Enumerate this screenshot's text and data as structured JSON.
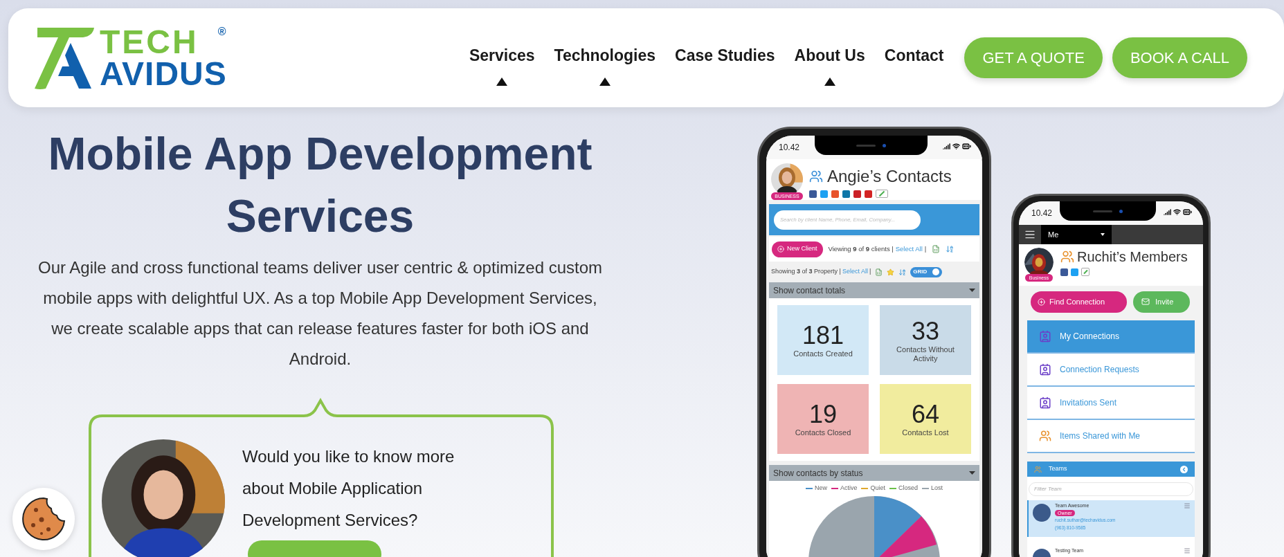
{
  "logo": {
    "line_1": "TECH",
    "line_2": "AVIDUS",
    "mark": "®"
  },
  "nav": [
    {
      "label": "Services",
      "has_menu": true
    },
    {
      "label": "Technologies",
      "has_menu": true
    },
    {
      "label": "Case Studies",
      "has_menu": false
    },
    {
      "label": "About Us",
      "has_menu": true
    },
    {
      "label": "Contact",
      "has_menu": false
    }
  ],
  "actions": [
    "GET A QUOTE",
    "BOOK A CALL"
  ],
  "hero": {
    "title": "Mobile App Development Services",
    "description": "Our Agile and cross functional teams deliver user centric & optimized custom mobile apps with delightful UX. As a top Mobile App Development Services, we create scalable apps that can release features faster for both iOS and Android."
  },
  "consult": {
    "question": "Would you like to know more about Mobile Application Development Services?"
  },
  "phone_1": {
    "time": "10.42",
    "title": "Angie’s Contacts",
    "badge": "BUSINESS",
    "search": {
      "placeholder": "Search by client Name, Phone, Email, Company..."
    },
    "new_button": "New Client",
    "viewing": "Viewing **9** of **9** clients |",
    "viewing_link": "Select All",
    "separator": "|",
    "showing": "Showing **3** of **3** Property |",
    "showing_link": "Select All",
    "toggle": {
      "label": "GRID",
      "on": true
    },
    "totals_header": "Show contact totals",
    "tiles": [
      {
        "value": "181",
        "label": "Contacts Created",
        "color": "#d2e8f6"
      },
      {
        "value": "33",
        "label": "Contacts Without Activity",
        "color": "#c9dbe8"
      },
      {
        "value": "19",
        "label": "Contacts Closed",
        "color": "#efb4b4"
      },
      {
        "value": "64",
        "label": "Contacts Lost",
        "color": "#f1ec9e"
      }
    ],
    "status_header": "Show contacts by status",
    "legend": [
      {
        "label": "New",
        "color": "#4a90c8"
      },
      {
        "label": "Active",
        "color": "#d6287f"
      },
      {
        "label": "Quiet",
        "color": "#e0a82e"
      },
      {
        "label": "Closed",
        "color": "#6cc04a"
      },
      {
        "label": "Lost",
        "color": "#9aa5ad"
      }
    ]
  },
  "phone_2": {
    "time": "10.42",
    "account": "Me",
    "title": "Ruchit’s Members",
    "badge": "Business",
    "find_button": "Find Connection",
    "invite_button": "Invite",
    "menu": [
      {
        "label": "My Connections",
        "selected": true
      },
      {
        "label": "Connection Requests",
        "selected": false
      },
      {
        "label": "Invitations Sent",
        "selected": false
      },
      {
        "label": "Items Shared with Me",
        "selected": false
      }
    ],
    "teams_header": "Teams",
    "filter": {
      "placeholder": "Filter Team"
    },
    "teams": [
      {
        "name": "Team Awesome",
        "role": "Owner",
        "email": "ruchit.suthar@techavidus.com",
        "phone": "(963) 810-9585",
        "selected": true
      },
      {
        "name": "Testing Team",
        "selected": false
      }
    ]
  }
}
